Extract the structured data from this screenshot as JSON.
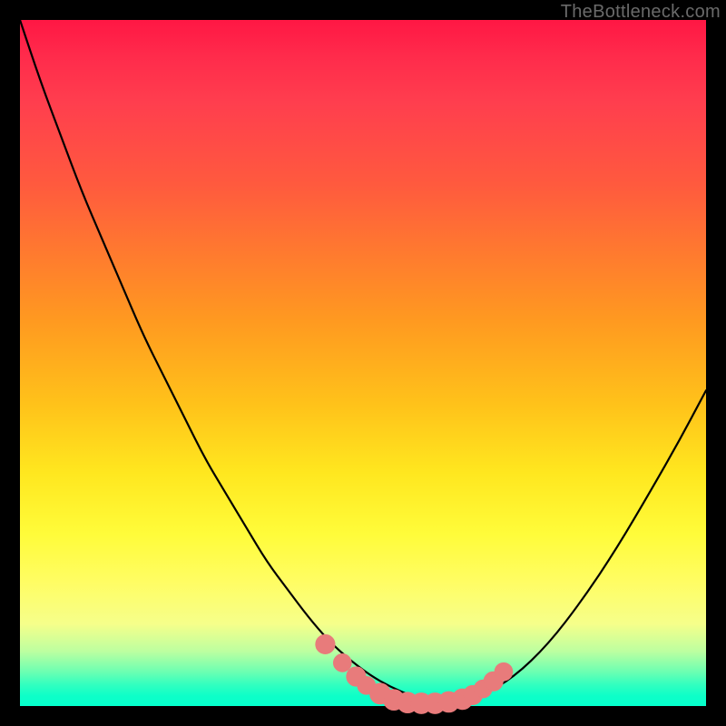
{
  "watermark": "TheBottleneck.com",
  "colors": {
    "frame_bg": "#000000",
    "watermark_text": "#6a6a6a",
    "curve_stroke": "#000000",
    "marker_fill": "#e87b7b",
    "gradient_top": "#ff1744",
    "gradient_mid": "#ffe71f",
    "gradient_bottom": "#05ffcc"
  },
  "chart_data": {
    "type": "line",
    "title": "",
    "xlabel": "",
    "ylabel": "",
    "xlim": [
      0,
      100
    ],
    "ylim": [
      0,
      100
    ],
    "grid": false,
    "legend": false,
    "series": [
      {
        "name": "bottleneck-curve",
        "x": [
          0,
          3,
          6,
          9,
          12,
          15,
          18,
          21,
          24,
          27,
          30,
          33,
          36,
          39,
          42,
          45,
          48,
          51,
          54,
          57,
          60,
          62,
          64,
          67,
          72,
          77,
          82,
          87,
          92,
          96,
          100
        ],
        "y": [
          100,
          91,
          83,
          75,
          68,
          61,
          54,
          48,
          42,
          36,
          31,
          26,
          21,
          17,
          13,
          9.5,
          6.8,
          4.5,
          2.8,
          1.5,
          0.7,
          0.3,
          0.5,
          1.3,
          4.2,
          9.0,
          15.5,
          23.0,
          31.5,
          38.5,
          46.0
        ]
      }
    ],
    "markers": [
      {
        "x": 44.5,
        "y": 9.0,
        "r": 1.4
      },
      {
        "x": 47.0,
        "y": 6.3,
        "r": 1.3
      },
      {
        "x": 49.0,
        "y": 4.3,
        "r": 1.4
      },
      {
        "x": 50.5,
        "y": 3.0,
        "r": 1.3
      },
      {
        "x": 52.5,
        "y": 1.8,
        "r": 1.5
      },
      {
        "x": 54.5,
        "y": 0.9,
        "r": 1.5
      },
      {
        "x": 56.5,
        "y": 0.5,
        "r": 1.5
      },
      {
        "x": 58.5,
        "y": 0.4,
        "r": 1.5
      },
      {
        "x": 60.5,
        "y": 0.4,
        "r": 1.5
      },
      {
        "x": 62.5,
        "y": 0.6,
        "r": 1.5
      },
      {
        "x": 64.5,
        "y": 1.0,
        "r": 1.5
      },
      {
        "x": 66.0,
        "y": 1.6,
        "r": 1.4
      },
      {
        "x": 67.5,
        "y": 2.5,
        "r": 1.3
      },
      {
        "x": 69.0,
        "y": 3.6,
        "r": 1.4
      },
      {
        "x": 70.5,
        "y": 5.0,
        "r": 1.3
      }
    ],
    "annotations": []
  }
}
